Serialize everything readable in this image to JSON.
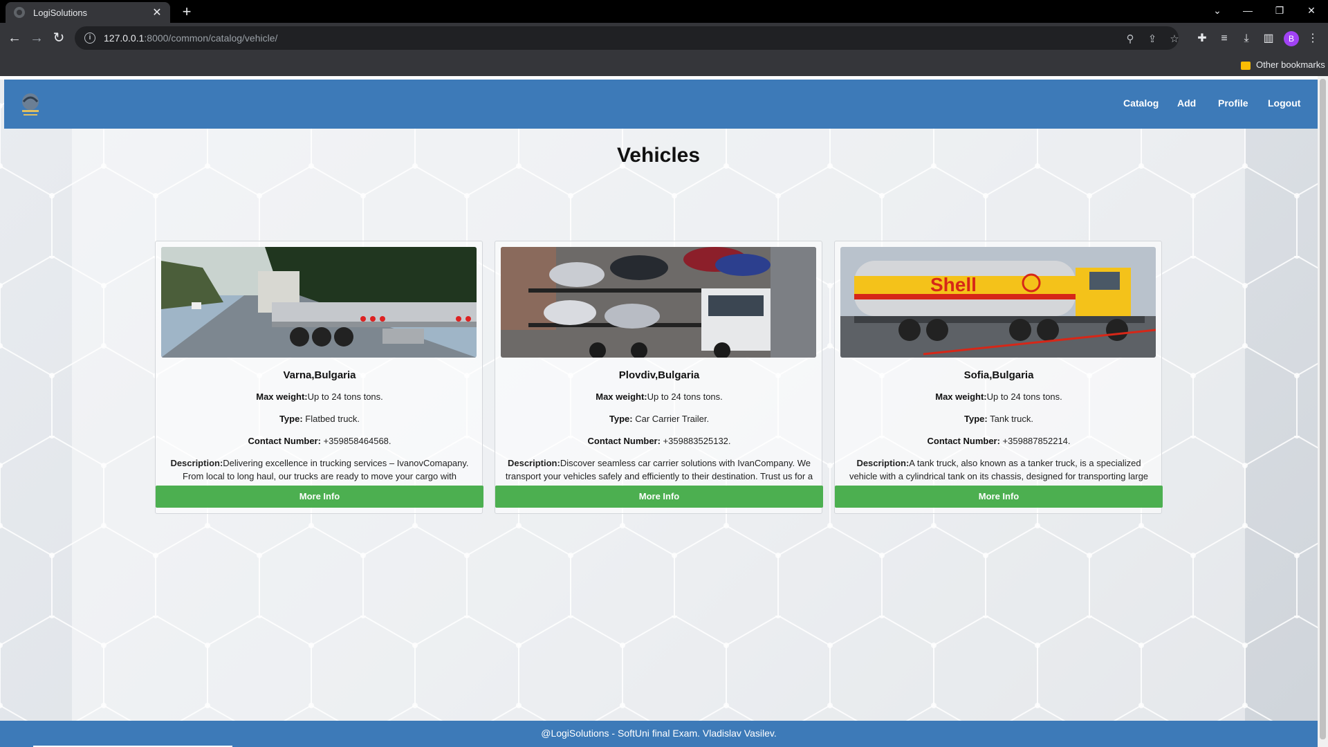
{
  "browser": {
    "tab_title": "LogiSolutions",
    "url_host": "127.0.0.1",
    "url_path": ":8000/common/catalog/vehicle/",
    "bookmarks_label": "Other bookmarks",
    "profile_initial": "B"
  },
  "header": {
    "nav": [
      "Catalog",
      "Add",
      "Profile",
      "Logout"
    ]
  },
  "page": {
    "title": "Vehicles"
  },
  "labels": {
    "max_weight": "Max weight:",
    "type": "Type:",
    "contact": "Contact Number:",
    "description": "Description:",
    "more_info": "More Info"
  },
  "vehicles": [
    {
      "location": "Varna,Bulgaria",
      "max_weight": "Up to 24 tons tons.",
      "type": " Flatbed truck.",
      "contact": " +359858464568.",
      "description": "Delivering excellence in trucking services – IvanovComapany. From local to long haul, our trucks are ready to move your cargo with precision",
      "image_name": "flatbed-truck-photo"
    },
    {
      "location": "Plovdiv,Bulgaria",
      "max_weight": "Up to 24 tons tons.",
      "type": " Car Carrier Trailer.",
      "contact": " +359883525132.",
      "description": "Discover seamless car carrier solutions with IvanCompany. We transport your vehicles safely and efficiently to their destination. Trust us for a",
      "image_name": "car-carrier-photo"
    },
    {
      "location": "Sofia,Bulgaria",
      "max_weight": "Up to 24 tons tons.",
      "type": " Tank truck.",
      "contact": " +359887852214.",
      "description": "A tank truck, also known as a tanker truck, is a specialized vehicle with a cylindrical tank on its chassis, designed for transporting large quantities of",
      "image_name": "tank-truck-photo",
      "tank_brand": "Shell"
    }
  ],
  "footer": {
    "text": "@LogiSolutions - SoftUni final Exam. Vladislav Vasilev."
  },
  "colors": {
    "header_blue": "#3d7ab8",
    "button_green": "#4caf50"
  }
}
